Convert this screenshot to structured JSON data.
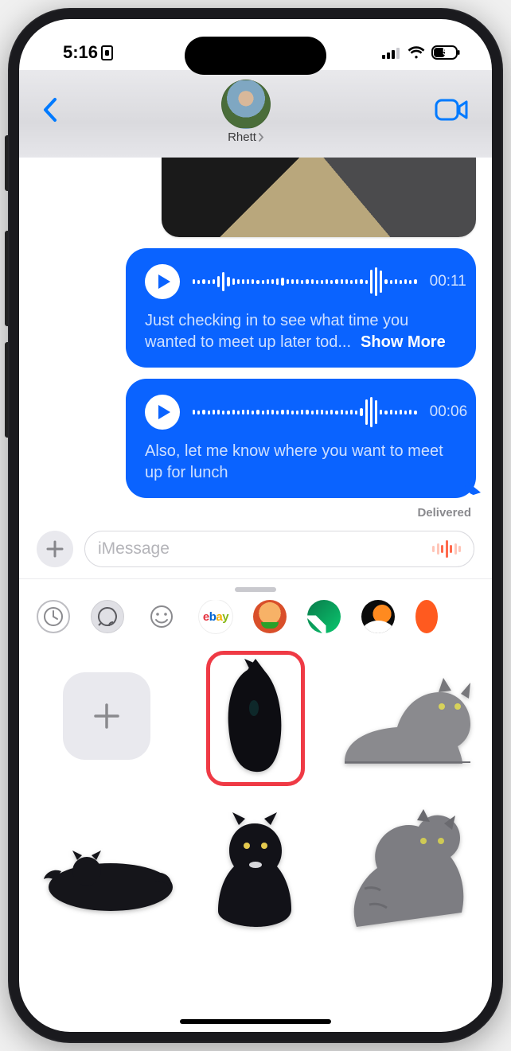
{
  "statusbar": {
    "time": "5:16",
    "battery": "50"
  },
  "nav": {
    "contact_name": "Rhett"
  },
  "messages": {
    "audio1": {
      "duration": "00:11",
      "transcript": "Just checking in to see what time you wanted to meet up later tod...",
      "show_more": "Show More"
    },
    "audio2": {
      "duration": "00:06",
      "transcript": "Also, let me know where you want to meet up for lunch"
    },
    "delivered": "Delivered"
  },
  "compose": {
    "placeholder": "iMessage"
  },
  "apps": {
    "ebay": {
      "e": "e",
      "b": "b",
      "a": "a",
      "y": "y"
    }
  },
  "icons": {
    "recent": "recent-icon",
    "sticker": "sticker-leaf-icon",
    "emoji": "emoji-icon"
  }
}
